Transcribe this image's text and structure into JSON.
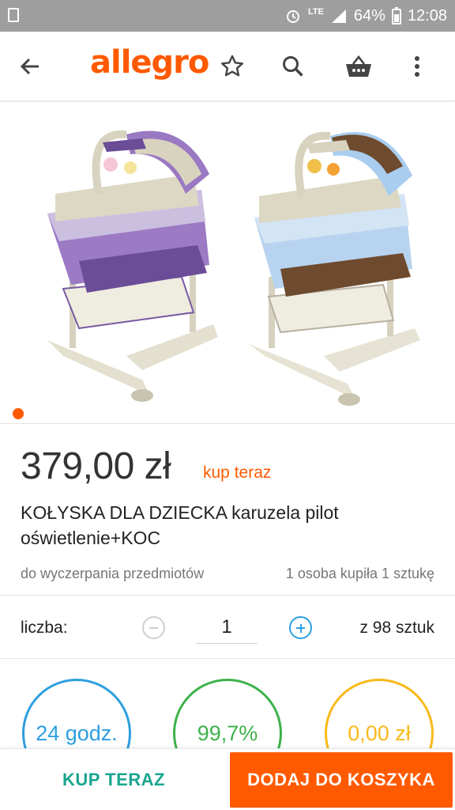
{
  "status_bar": {
    "network": "LTE",
    "battery": "64%",
    "time": "12:08"
  },
  "app_bar": {
    "logo": "allegro",
    "icons": [
      "back-arrow-icon",
      "star-icon",
      "search-icon",
      "basket-icon",
      "more-vertical-icon"
    ]
  },
  "gallery": {
    "images": [
      "cradle-purple",
      "cradle-blue"
    ],
    "active_index": 0,
    "colors": {
      "purple": "#8a64b4",
      "blue": "#a9cdee",
      "brown": "#6e4a2e",
      "beige": "#dcd8c4"
    }
  },
  "listing": {
    "price": "379,00 zł",
    "buy_now_tag": "kup teraz",
    "title": "KOŁYSKA DLA DZIECKA karuzela pilot oświetlenie+KOC",
    "availability": "do wyczerpania przedmiotów",
    "sold_info": "1 osoba kupiła 1 sztukę"
  },
  "quantity": {
    "label": "liczba:",
    "value": "1",
    "total": "z 98 sztuk"
  },
  "stats": {
    "shipping_time": "24 godz.",
    "rating": "99,7%",
    "delivery_cost": "0,00 zł"
  },
  "actions": {
    "buy_now": "KUP TERAZ",
    "add_to_cart": "DODAJ DO KOSZYKA"
  },
  "colors": {
    "accent": "#ff5a00",
    "teal": "#1aa58f",
    "blue": "#2d9fe0",
    "green": "#3db24a",
    "yellow": "#f9b91a"
  }
}
